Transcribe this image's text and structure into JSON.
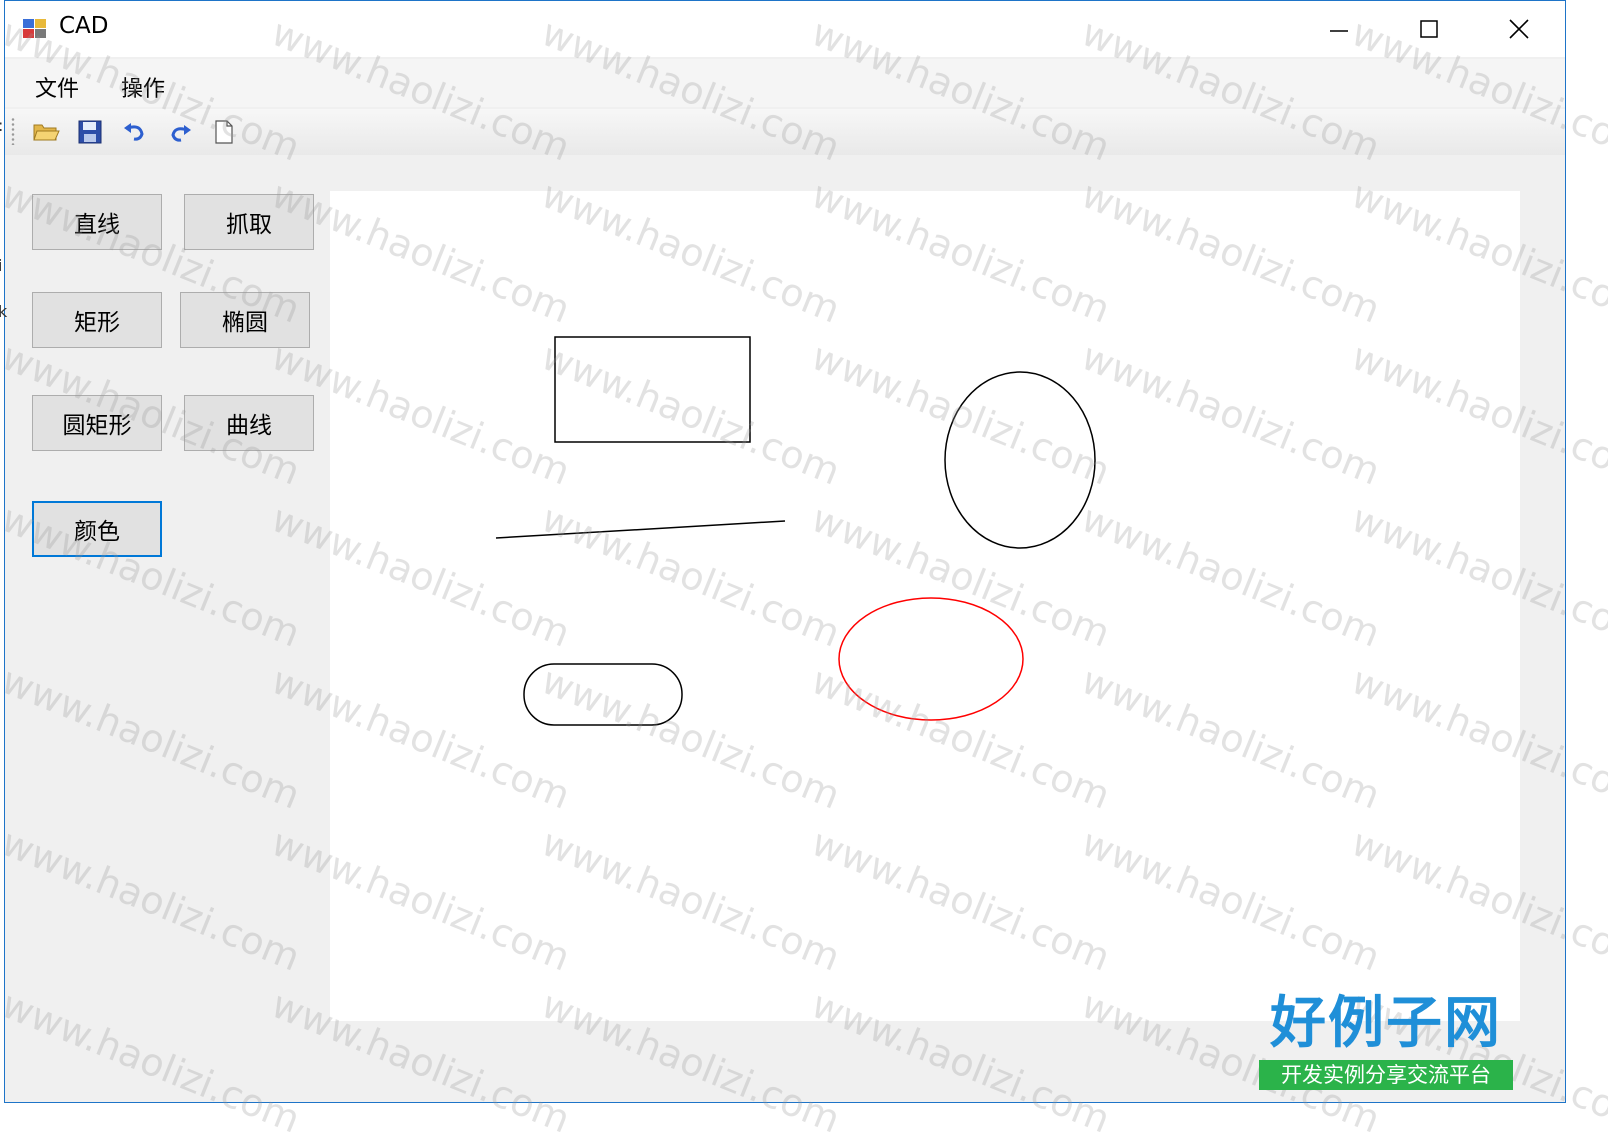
{
  "window": {
    "title": "CAD",
    "controls": {
      "minimize": "minimize-icon",
      "maximize": "maximize-icon",
      "close": "close-icon"
    }
  },
  "menubar": {
    "items": [
      {
        "label": "文件"
      },
      {
        "label": "操作"
      }
    ]
  },
  "toolbar": {
    "buttons": [
      {
        "name": "open-button",
        "icon": "folder-open-icon"
      },
      {
        "name": "save-button",
        "icon": "save-icon"
      },
      {
        "name": "undo-button",
        "icon": "undo-icon"
      },
      {
        "name": "redo-button",
        "icon": "redo-icon"
      },
      {
        "name": "new-button",
        "icon": "new-document-icon"
      }
    ]
  },
  "tools": {
    "line": "直线",
    "grab": "抓取",
    "rectangle": "矩形",
    "ellipse": "椭圆",
    "rounded_rect": "圆矩形",
    "curve": "曲线",
    "color": "颜色"
  },
  "canvas": {
    "shapes": [
      {
        "type": "rectangle",
        "stroke": "#000000"
      },
      {
        "type": "ellipse",
        "stroke": "#000000"
      },
      {
        "type": "line",
        "stroke": "#000000"
      },
      {
        "type": "rounded-rectangle",
        "stroke": "#000000"
      },
      {
        "type": "ellipse",
        "stroke": "#ff0000"
      }
    ]
  },
  "watermark": {
    "text": "www.haolizi.com"
  },
  "logo": {
    "main": "好例子网",
    "sub": "开发实例分享交流平台"
  },
  "colors": {
    "accent": "#0078d7",
    "logo_blue": "#1f8fd8",
    "logo_green": "#2bb34a"
  }
}
